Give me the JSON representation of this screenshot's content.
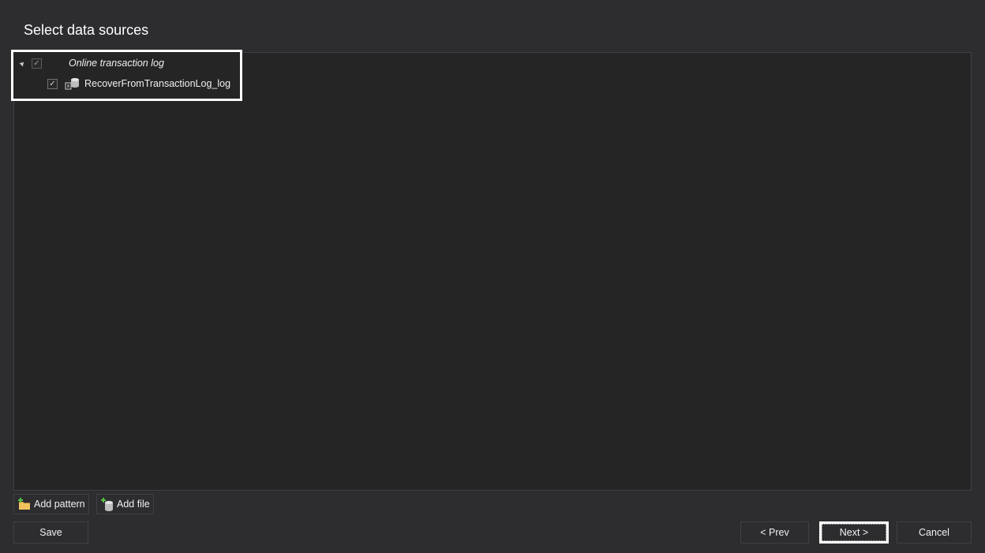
{
  "page": {
    "title": "Select data sources"
  },
  "tree": {
    "items": [
      {
        "label": "Online transaction log",
        "checked": true,
        "expanded": true,
        "icon": "collapse-triangle-icon"
      },
      {
        "label": "RecoverFromTransactionLog_log",
        "checked": true,
        "icon": "database-log-icon"
      }
    ]
  },
  "toolbar": {
    "add_pattern_label": "Add pattern",
    "add_pattern_icon": "folder-add-icon",
    "add_file_label": "Add file",
    "add_file_icon": "database-add-icon"
  },
  "footer": {
    "save_label": "Save",
    "prev_label": "< Prev",
    "next_label": "Next >",
    "cancel_label": "Cancel"
  },
  "colors": {
    "background": "#2d2d30",
    "panel": "#252526",
    "border": "#3f3f46",
    "text": "#f1f1f1",
    "highlight": "#ffffff"
  }
}
